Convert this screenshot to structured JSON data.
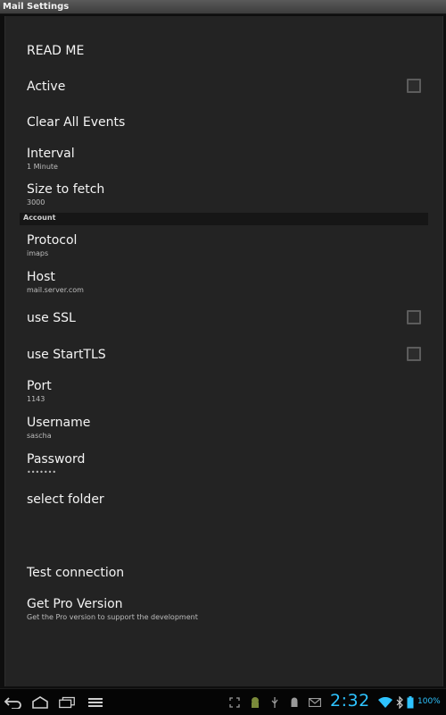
{
  "window": {
    "title": "Mail Settings"
  },
  "prefs": {
    "readme": {
      "title": "READ ME"
    },
    "active": {
      "title": "Active",
      "checked": false
    },
    "clear_events": {
      "title": "Clear All Events"
    },
    "interval": {
      "title": "Interval",
      "summary": "1 Minute"
    },
    "size_to_fetch": {
      "title": "Size to fetch",
      "summary": "3000"
    },
    "account_category": {
      "title": "Account"
    },
    "protocol": {
      "title": "Protocol",
      "summary": "imaps"
    },
    "host": {
      "title": "Host",
      "summary": "mail.server.com"
    },
    "use_ssl": {
      "title": "use SSL",
      "checked": false
    },
    "use_starttls": {
      "title": "use StartTLS",
      "checked": false
    },
    "port": {
      "title": "Port",
      "summary": "1143"
    },
    "username": {
      "title": "Username",
      "summary": "sascha"
    },
    "password": {
      "title": "Password",
      "summary": "•••••••"
    },
    "select_folder": {
      "title": "select folder"
    },
    "test_connection": {
      "title": "Test connection"
    },
    "pro_version": {
      "title": "Get Pro Version",
      "summary": "Get the Pro version to support the development"
    }
  },
  "navbar": {
    "icons": [
      "back-icon",
      "home-icon",
      "recent-apps-icon",
      "menu-icon"
    ]
  },
  "status_bar": {
    "icons": [
      "screenshot-icon",
      "android-icon",
      "usb-icon",
      "android-debug-icon",
      "mail-icon",
      "wifi-icon",
      "bluetooth-icon",
      "battery-icon"
    ],
    "time": "2:32",
    "battery": "100%",
    "accent_color": "#2ec3ff"
  }
}
